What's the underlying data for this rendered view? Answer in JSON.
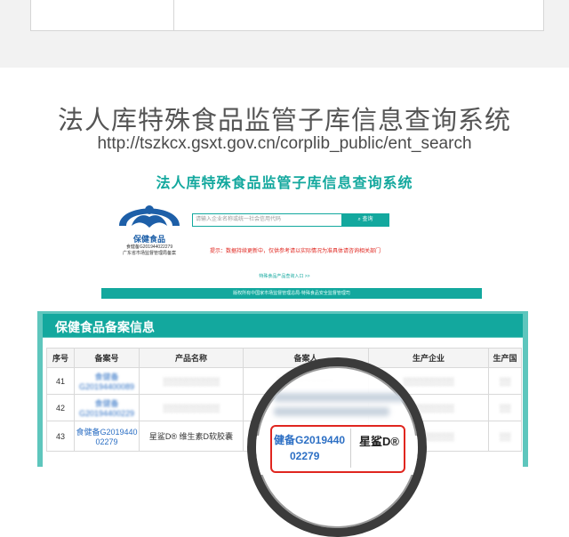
{
  "heading": "法人库特殊食品监管子库信息查询系统",
  "url": "http://tszkcx.gsxt.gov.cn/corplib_public/ent_search",
  "site": {
    "title": "法人库特殊食品监管子库信息查询系统",
    "logo_name": "保健食品",
    "logo_sub1": "食健备G201944022279",
    "logo_sub2": "广东省市场监督管理局备案",
    "search_placeholder": "请输入企业名称或统一社会信用代码",
    "search_button": "查询",
    "notice": "提示：数据持续更新中，仅供参考请以实际情况为准具体请咨询相关部门",
    "entry_link": "特殊食品产品查询入口 >>",
    "footer": "版权所有中国家市场监督管理总局-特殊食品安全监督管理司"
  },
  "panel": {
    "title": "保健食品备案信息",
    "columns": [
      "序号",
      "备案号",
      "产品名称",
      "备案人",
      "生产企业",
      "生产国"
    ],
    "rows": [
      {
        "no": "41",
        "code": "食健备G20194400089",
        "name": "",
        "filer": "",
        "maker": "",
        "country": ""
      },
      {
        "no": "42",
        "code": "食健备G20194400229",
        "name": "",
        "filer": "",
        "maker": "",
        "country": ""
      },
      {
        "no": "43",
        "code": "食健备G2019440 02279",
        "name": "星鲨D® 维生素D软胶囊",
        "filer": "",
        "maker": "",
        "country": ""
      }
    ]
  },
  "lens": {
    "code_line1": "健备G2019440",
    "code_line2": "02279",
    "brand": "星鲨D®"
  }
}
